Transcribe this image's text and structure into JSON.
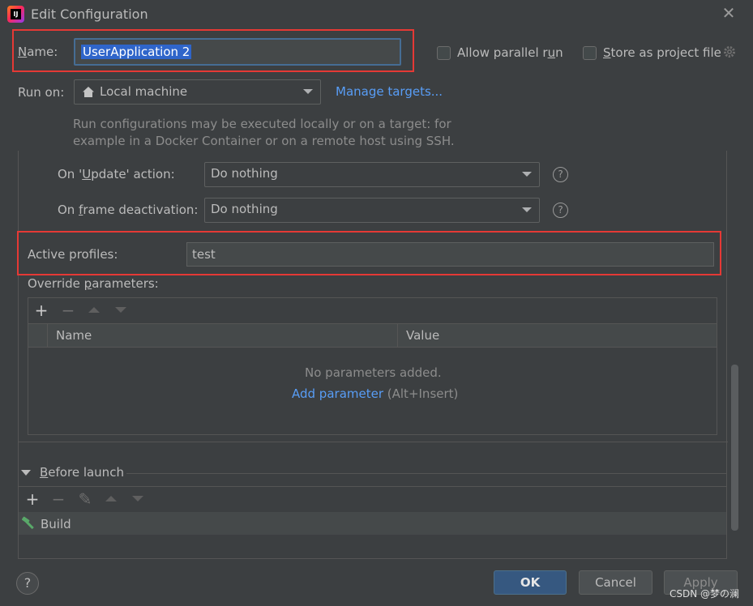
{
  "window": {
    "title": "Edit Configuration",
    "app_icon_glyph": "IJ"
  },
  "name_row": {
    "label_first": "N",
    "label_rest": "ame:",
    "value": "UserApplication 2"
  },
  "options": {
    "allow_parallel_pre": "Allow parallel r",
    "allow_parallel_u": "u",
    "allow_parallel_post": "n",
    "store_u": "S",
    "store_rest": "tore as project file"
  },
  "run_on": {
    "label": "Run on:",
    "value": "Local machine",
    "manage_link": "Manage targets...",
    "hint_line1": "Run configurations may be executed locally or on a target: for",
    "hint_line2": "example in a Docker Container or on a remote host using SSH."
  },
  "update_action": {
    "label_pre": "On '",
    "label_u": "U",
    "label_post": "pdate' action:",
    "value": "Do nothing"
  },
  "frame_deactivation": {
    "label_pre": "On ",
    "label_u": "f",
    "label_post": "rame deactivation:",
    "value": "Do nothing"
  },
  "help_glyph": "?",
  "active_profiles": {
    "label": "Active profiles:",
    "value": "test"
  },
  "override": {
    "label_pre": "Override ",
    "label_u": "p",
    "label_post": "arameters:",
    "toolbar": {
      "add": "+",
      "remove": "−"
    },
    "columns": [
      "Name",
      "Value"
    ],
    "empty_text": "No parameters added.",
    "add_link": "Add parameter",
    "shortcut": "(Alt+Insert)"
  },
  "before_launch": {
    "label_u": "B",
    "label_rest": "efore launch",
    "toolbar": {
      "add": "+",
      "remove": "−",
      "edit": "✎"
    },
    "items": [
      "Build"
    ]
  },
  "footer": {
    "help": "?",
    "ok": "OK",
    "cancel": "Cancel",
    "apply": "Apply"
  },
  "watermark": "CSDN @梦の澜",
  "colors": {
    "background": "#3c3f41",
    "highlight_frame": "#e53935",
    "link": "#589df6",
    "primary_button": "#365880",
    "selection": "#2f65ca"
  }
}
